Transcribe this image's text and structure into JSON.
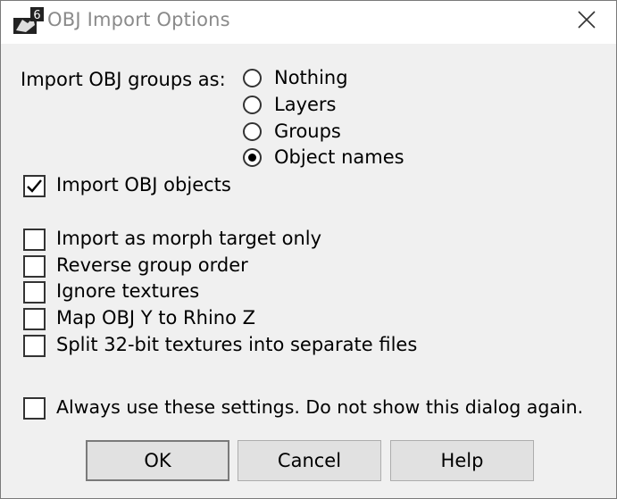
{
  "window": {
    "title": "OBJ Import Options",
    "app_icon": "rhino-6-icon",
    "close_icon": "close-icon"
  },
  "groups": {
    "label": "Import OBJ groups as:",
    "options": [
      {
        "label": "Nothing",
        "checked": false
      },
      {
        "label": "Layers",
        "checked": false
      },
      {
        "label": "Groups",
        "checked": false
      },
      {
        "label": "Object names",
        "checked": true
      }
    ]
  },
  "checkboxes": [
    {
      "label": "Import OBJ objects",
      "checked": true
    },
    {
      "label": "Import as morph target only",
      "checked": false
    },
    {
      "label": "Reverse group order",
      "checked": false
    },
    {
      "label": "Ignore textures",
      "checked": false
    },
    {
      "label": "Map OBJ Y to Rhino Z",
      "checked": false
    },
    {
      "label": "Split 32-bit textures into separate files",
      "checked": false
    }
  ],
  "always": {
    "label": "Always use these settings. Do not show this dialog again.",
    "checked": false
  },
  "buttons": {
    "ok": "OK",
    "cancel": "Cancel",
    "help": "Help"
  }
}
